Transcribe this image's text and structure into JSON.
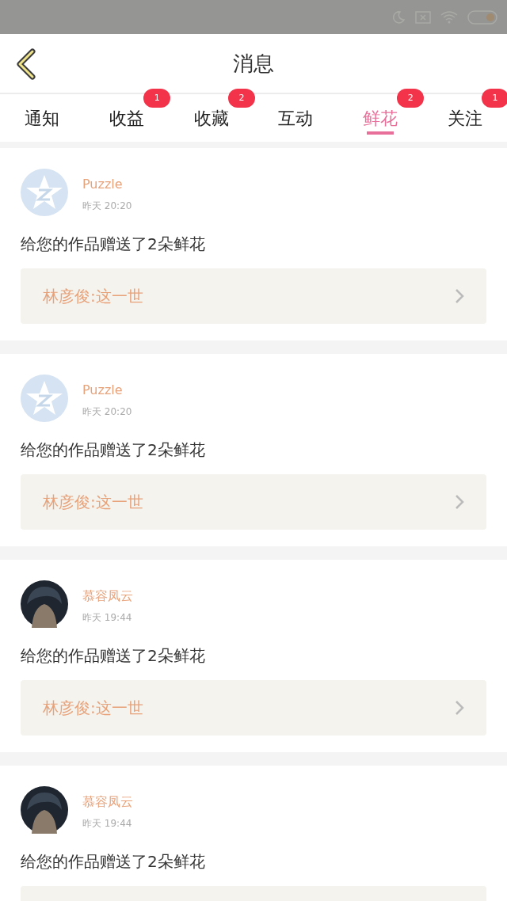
{
  "header": {
    "title": "消息"
  },
  "tabs": [
    {
      "label": "通知",
      "selected": false
    },
    {
      "label": "收益",
      "selected": false,
      "badge": "1"
    },
    {
      "label": "收藏",
      "selected": false,
      "badge": "2"
    },
    {
      "label": "互动",
      "selected": false
    },
    {
      "label": "鲜花",
      "selected": true,
      "badge": "2"
    },
    {
      "label": "关注",
      "selected": false,
      "badge": "1"
    }
  ],
  "messages": [
    {
      "kind": "star",
      "name": "Puzzle",
      "time": "昨天 20:20",
      "text": "给您的作品赠送了2朵鲜花",
      "link": "林彦俊:这一世"
    },
    {
      "kind": "star",
      "name": "Puzzle",
      "time": "昨天 20:20",
      "text": "给您的作品赠送了2朵鲜花",
      "link": "林彦俊:这一世"
    },
    {
      "kind": "person",
      "name": "慕容凤云",
      "time": "昨天 19:44",
      "text": "给您的作品赠送了2朵鲜花",
      "link": "林彦俊:这一世"
    },
    {
      "kind": "person",
      "name": "慕容凤云",
      "time": "昨天 19:44",
      "text": "给您的作品赠送了2朵鲜花"
    }
  ]
}
